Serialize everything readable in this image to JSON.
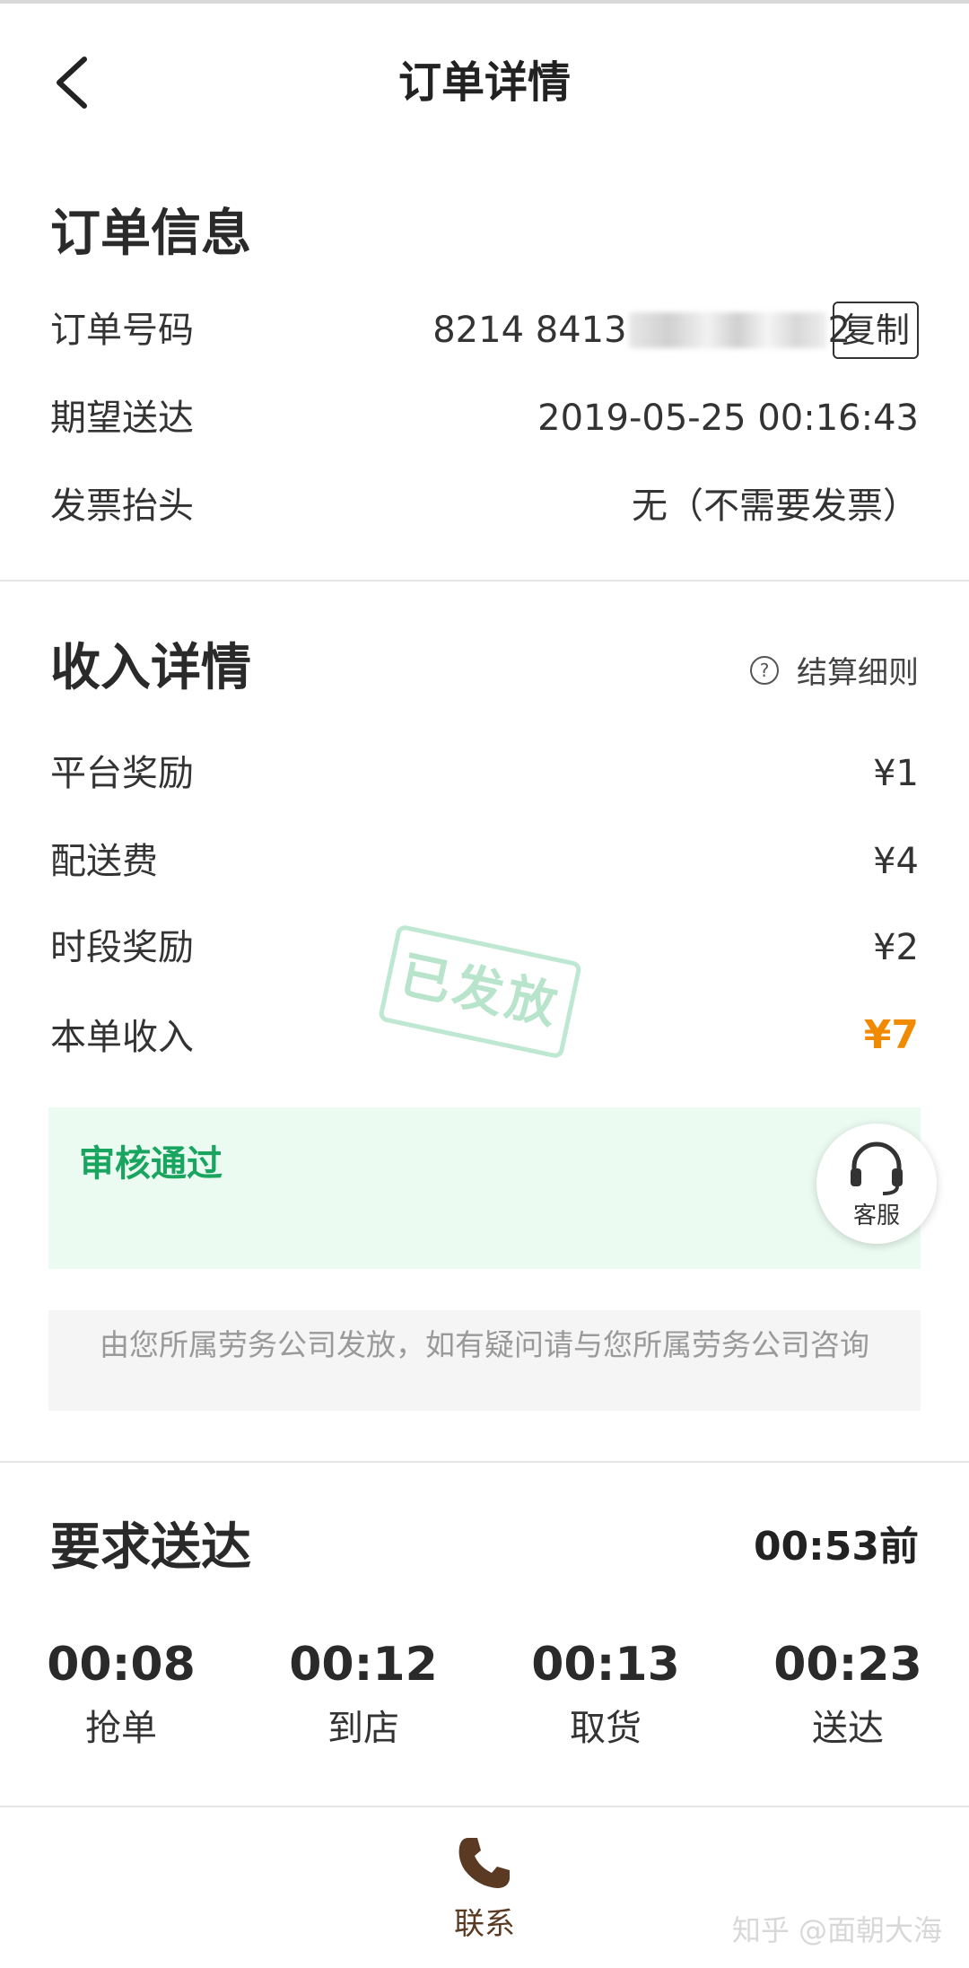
{
  "header": {
    "title": "订单详情"
  },
  "order_info": {
    "section_title": "订单信息",
    "order_number_label": "订单号码",
    "order_number_prefix": "8214 8413",
    "order_number_suffix": "2",
    "copy_label": "复制",
    "expected_label": "期望送达",
    "expected_value": "2019-05-25 00:16:43",
    "invoice_label": "发票抬头",
    "invoice_value": "无（不需要发票）"
  },
  "income": {
    "section_title": "收入详情",
    "rules_label": "结算细则",
    "rules_icon": "?",
    "rows": [
      {
        "label": "平台奖励",
        "value": "¥1"
      },
      {
        "label": "配送费",
        "value": "¥4"
      },
      {
        "label": "时段奖励",
        "value": "¥2"
      }
    ],
    "total_label": "本单收入",
    "total_value": "¥7",
    "total_color": "#f08a00",
    "stamp_text": "已发放",
    "audit_status": "审核通过",
    "audit_color": "#19a55f",
    "notice": "由您所属劳务公司发放，如有疑问请与您所属劳务公司咨询"
  },
  "service": {
    "label": "客服",
    "icon": "headset-icon"
  },
  "delivery": {
    "section_title": "要求送达",
    "deadline": "00:53前",
    "steps": [
      {
        "time": "00:08",
        "label": "抢单"
      },
      {
        "time": "00:12",
        "label": "到店"
      },
      {
        "time": "00:13",
        "label": "取货"
      },
      {
        "time": "00:23",
        "label": "送达"
      }
    ]
  },
  "bottom": {
    "contact_label": "联系",
    "contact_icon": "phone-icon",
    "accent": "#5a3a22"
  },
  "watermark": "知乎 @面朝大海"
}
